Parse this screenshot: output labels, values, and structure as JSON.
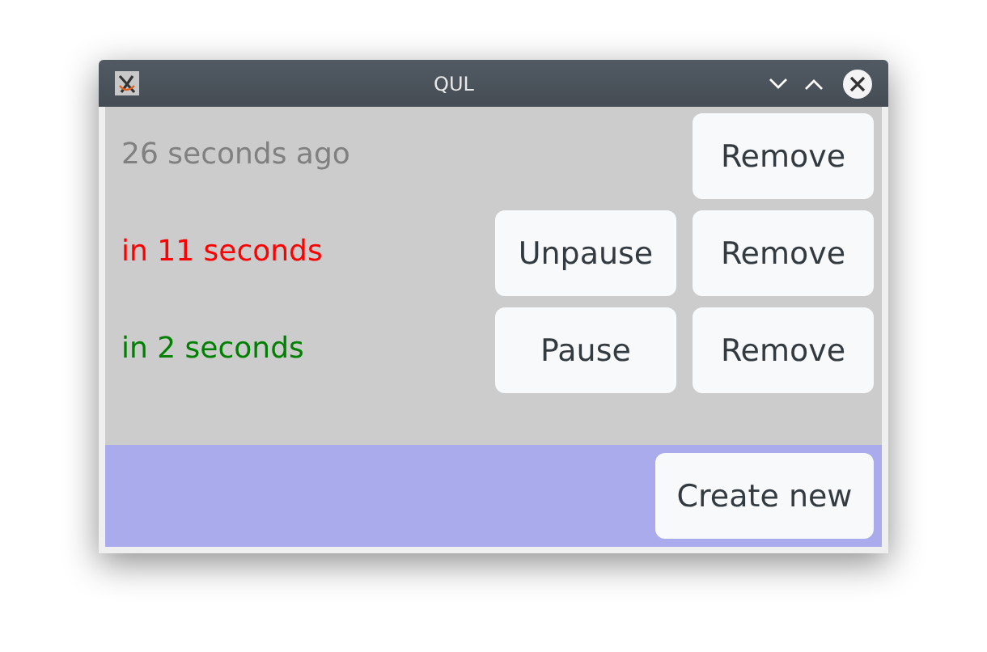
{
  "window": {
    "title": "QUL"
  },
  "timers": [
    {
      "text": "26 seconds ago",
      "color": "#808080",
      "buttons": [
        "Remove"
      ]
    },
    {
      "text": "in 11 seconds",
      "color": "#ff0000",
      "buttons": [
        "Unpause",
        "Remove"
      ]
    },
    {
      "text": "in 2 seconds",
      "color": "#008000",
      "buttons": [
        "Pause",
        "Remove"
      ]
    }
  ],
  "footer": {
    "button": "Create new"
  }
}
